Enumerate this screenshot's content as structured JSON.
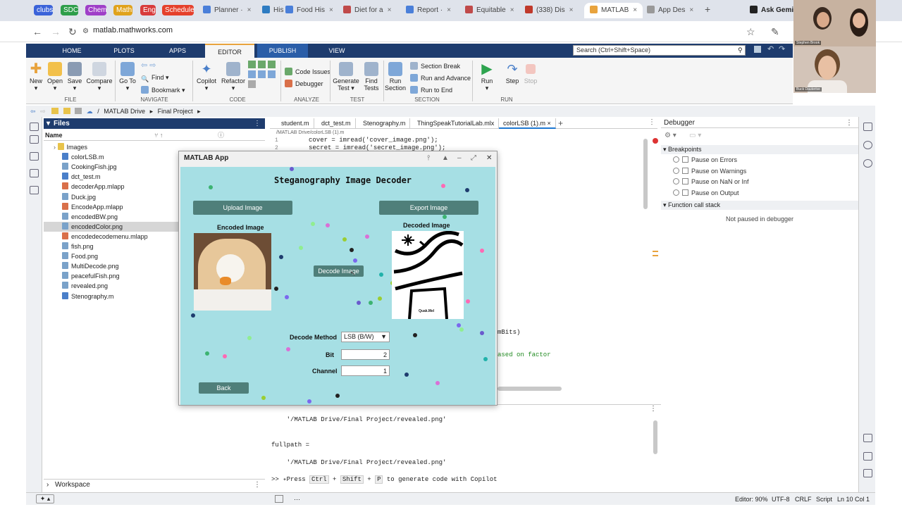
{
  "browser": {
    "bookmark_chips": [
      {
        "label": "clubs",
        "color": "#3b63d9"
      },
      {
        "label": "SDC",
        "color": "#2e9e4a"
      },
      {
        "label": "Chem",
        "color": "#9f3fc8"
      },
      {
        "label": "Math",
        "color": "#e0a21c"
      },
      {
        "label": "Eng",
        "color": "#d83b3b"
      },
      {
        "label": "Schedule",
        "color": "#e5402b"
      }
    ],
    "tabs": [
      {
        "label": "Planner ·"
      },
      {
        "label": "His"
      },
      {
        "label": "Food His"
      },
      {
        "label": "Diet for a"
      },
      {
        "label": "Report ·"
      },
      {
        "label": "Equitable"
      },
      {
        "label": "(338) Dis"
      },
      {
        "label": "MATLAB"
      },
      {
        "label": "App Des"
      },
      {
        "label": "Ask Gemini"
      }
    ],
    "url": "matlab.mathworks.com"
  },
  "toolstrip": {
    "tabs": [
      "HOME",
      "PLOTS",
      "APPS",
      "EDITOR",
      "PUBLISH",
      "VIEW"
    ],
    "search_placeholder": "Search (Ctrl+Shift+Space)",
    "buttons": {
      "new": "New",
      "open": "Open",
      "save": "Save",
      "compare": "Compare",
      "goto": "Go To",
      "find": "Find",
      "bookmark": "Bookmark",
      "copilot": "Copilot",
      "refactor": "Refactor",
      "code_issues": "Code Issues",
      "debugger": "Debugger",
      "generate_test": "Generate\nTest",
      "find_tests": "Find\nTests",
      "run_section": "Run\nSection",
      "section_break": "Section Break",
      "run_advance": "Run and Advance",
      "run_end": "Run to End",
      "run": "Run",
      "step": "Step",
      "stop": "Stop"
    },
    "groups": [
      "FILE",
      "NAVIGATE",
      "CODE",
      "ANALYZE",
      "TEST",
      "SECTION",
      "RUN"
    ]
  },
  "breadcrumb": [
    "MATLAB Drive",
    "Final Project"
  ],
  "files": {
    "title": "Files",
    "column": "Name",
    "items": [
      {
        "name": "Images",
        "type": "folder"
      },
      {
        "name": "colorLSB.m",
        "type": "m"
      },
      {
        "name": "CookingFish.jpg",
        "type": "img"
      },
      {
        "name": "dct_test.m",
        "type": "m"
      },
      {
        "name": "decoderApp.mlapp",
        "type": "app"
      },
      {
        "name": "Duck.jpg",
        "type": "img"
      },
      {
        "name": "EncodeApp.mlapp",
        "type": "app"
      },
      {
        "name": "encodedBW.png",
        "type": "img"
      },
      {
        "name": "encodedColor.png",
        "type": "img",
        "selected": true
      },
      {
        "name": "encodedecodemenu.mlapp",
        "type": "app"
      },
      {
        "name": "fish.png",
        "type": "img"
      },
      {
        "name": "Food.png",
        "type": "img"
      },
      {
        "name": "MultiDecode.png",
        "type": "img"
      },
      {
        "name": "peacefulFish.png",
        "type": "img"
      },
      {
        "name": "revealed.png",
        "type": "img"
      },
      {
        "name": "Stenography.m",
        "type": "m"
      }
    ],
    "workspace": "Workspace"
  },
  "editor": {
    "tabs": [
      "student.m",
      "dct_test.m",
      "Stenography.m",
      "ThingSpeakTutorialLab.mlx",
      "colorLSB (1).m"
    ],
    "path": "/MATLAB Drive/colorLSB (1).m",
    "lines": [
      {
        "num": "1",
        "text": "cover = imread('cover_image.png');"
      },
      {
        "num": "2",
        "text": "secret = imread('secret_image.png');"
      }
    ],
    "partial_right_1": "mBits)",
    "partial_right_2": "ased on factor"
  },
  "command_window": {
    "lines": [
      "    '/MATLAB Drive/Final Project/revealed.png'",
      "fullpath =",
      "    '/MATLAB Drive/Final Project/revealed.png'"
    ],
    "prompt": ">> ",
    "hint_parts": [
      "Press ",
      "Ctrl",
      " + ",
      "Shift",
      " + ",
      "P",
      " to generate code with Copilot"
    ]
  },
  "debugger": {
    "title": "Debugger",
    "breakpoints_label": "Breakpoints",
    "options": [
      "Pause on Errors",
      "Pause on Warnings",
      "Pause on NaN or Inf",
      "Pause on Output"
    ],
    "call_stack_label": "Function call stack",
    "call_stack_empty": "Not paused in debugger"
  },
  "status_bar": {
    "zoom": "Editor: 90%",
    "encoding": "UTF-8",
    "eol": "CRLF",
    "type": "Script",
    "position": "Ln 10 Col 1"
  },
  "video": {
    "top_name": "Stephen Brook",
    "bottom_name": "Buck Dauterive"
  },
  "app_dialog": {
    "window_title": "MATLAB App",
    "title": "Steganography Image Decoder",
    "upload_label": "Upload Image",
    "export_label": "Export Image",
    "encoded_label": "Encoded Image",
    "decoded_label": "Decoded Image",
    "decode_label": "Decode Image",
    "decode_method_label": "Decode Method",
    "decode_method_value": "LSB (B/W)",
    "bit_label": "Bit",
    "bit_value": "2",
    "channel_label": "Channel",
    "channel_value": "1",
    "back_label": "Back",
    "decoded_caption": "Quak.Mel",
    "background": "#a6dfe4",
    "button_color": "#4f7f7a"
  }
}
